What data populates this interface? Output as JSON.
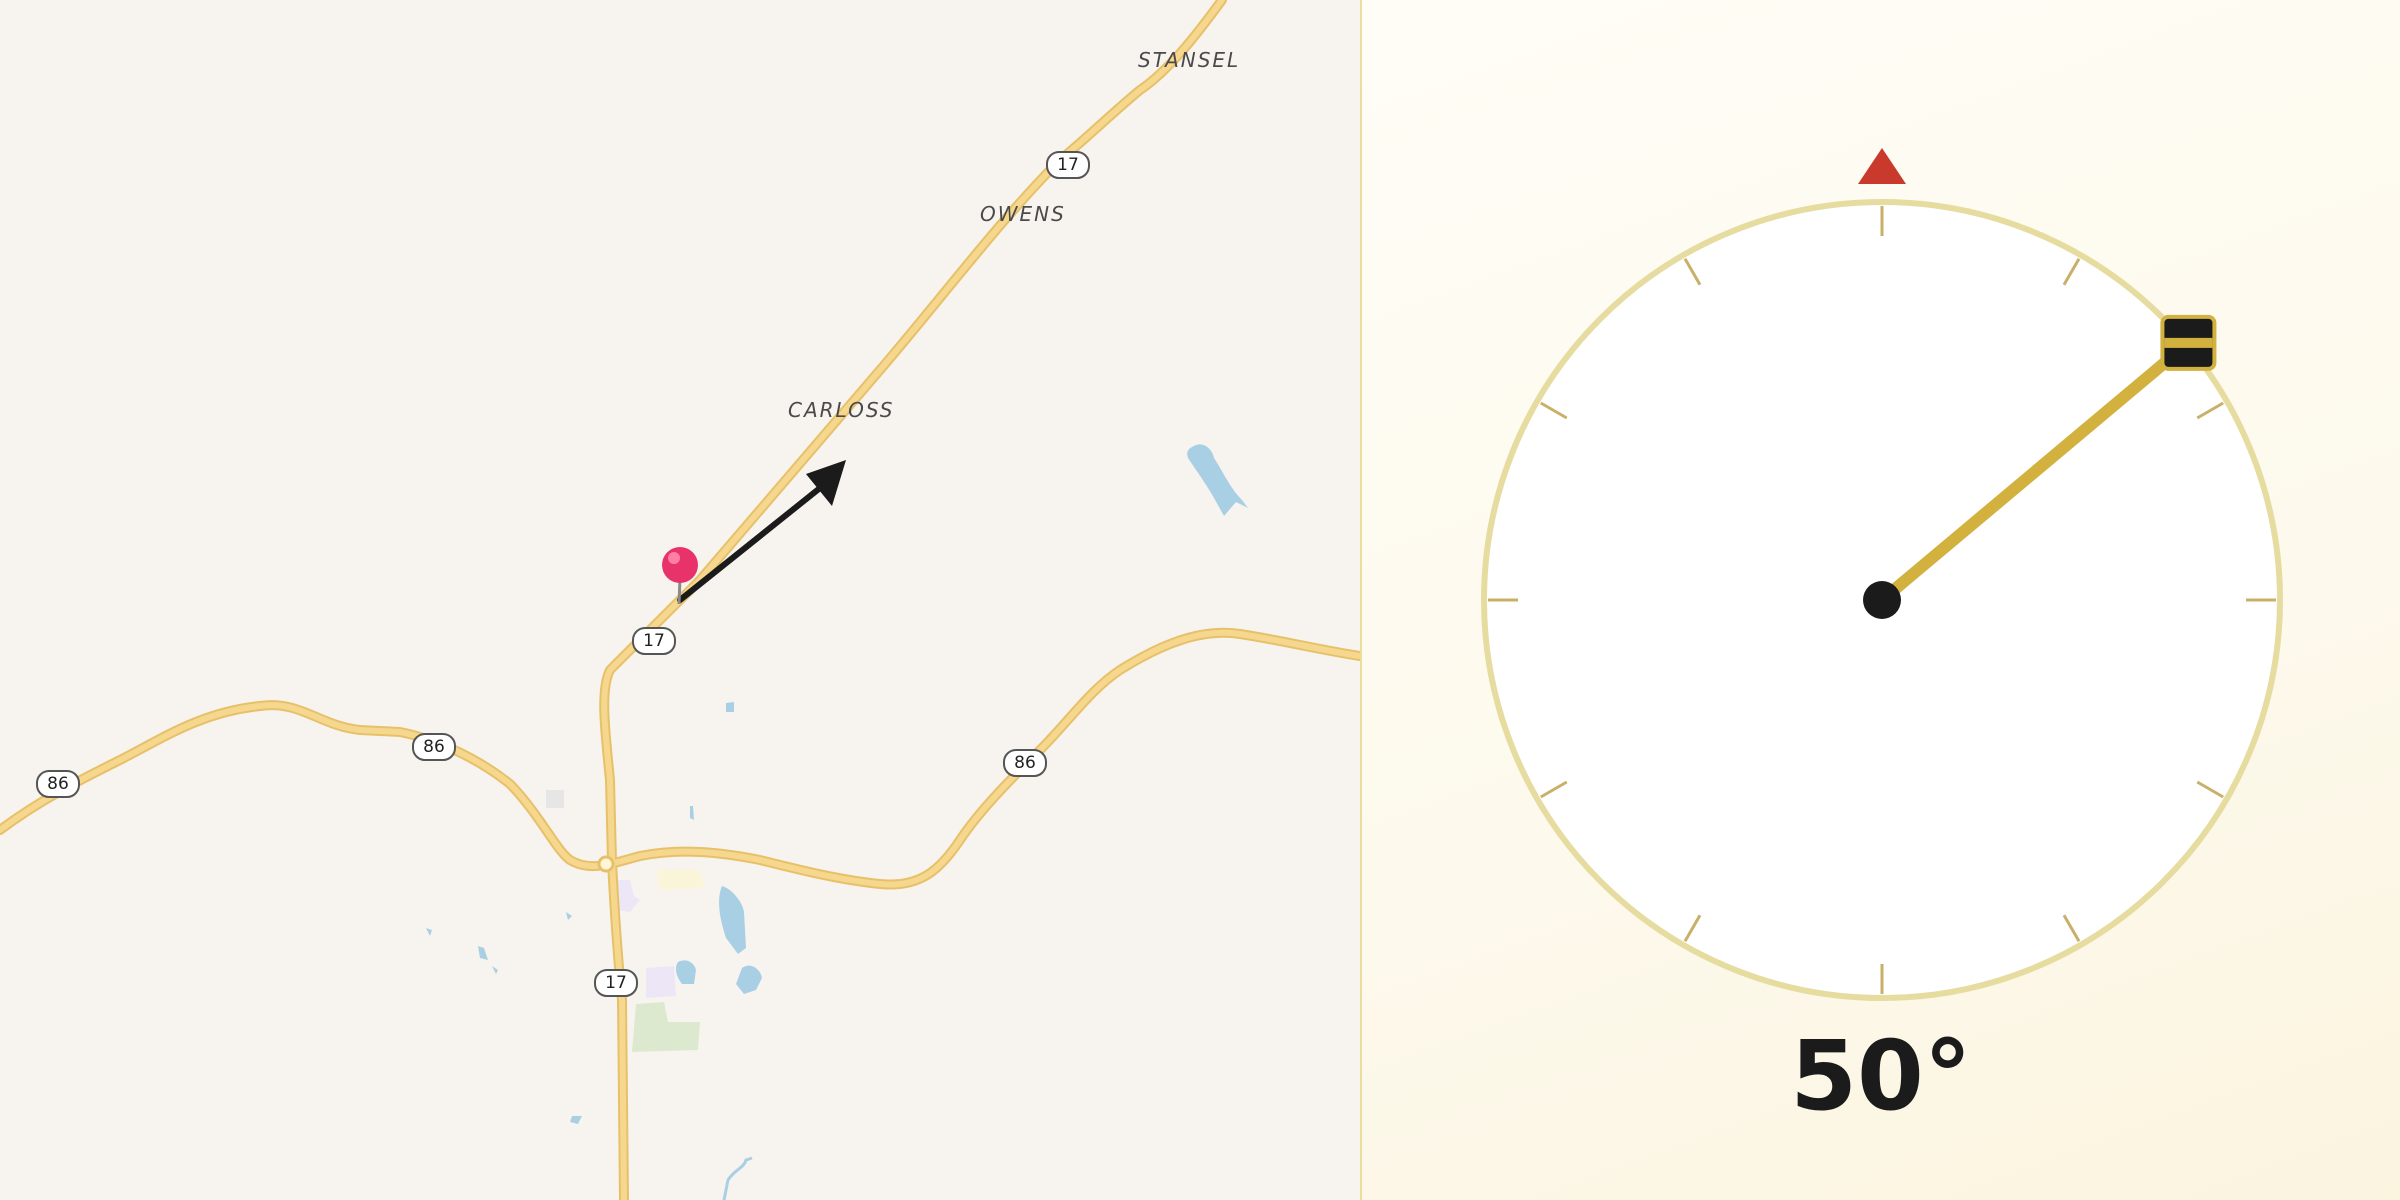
{
  "map": {
    "places": [
      {
        "id": "stansel",
        "label": "STANSEL"
      },
      {
        "id": "owens",
        "label": "OWENS"
      },
      {
        "id": "carloss",
        "label": "CARLOSS"
      }
    ],
    "route_shields": [
      {
        "id": "r17-north",
        "label": "17"
      },
      {
        "id": "r17-mid",
        "label": "17"
      },
      {
        "id": "r17-south",
        "label": "17"
      },
      {
        "id": "r86-west",
        "label": "86"
      },
      {
        "id": "r86-midwest",
        "label": "86"
      },
      {
        "id": "r86-east",
        "label": "86"
      }
    ],
    "icons": {
      "pin": "map-pin-icon",
      "direction_arrow": "direction-arrow-icon"
    },
    "colors": {
      "land": "#f7f4ef",
      "road": "#f6d27e",
      "water": "#a9cfe5",
      "pin": "#e8326a"
    }
  },
  "compass": {
    "heading_degrees": 50,
    "heading_label": "50°",
    "icons": {
      "north_marker": "north-triangle-icon",
      "needle_handle": "needle-handle-icon"
    },
    "colors": {
      "ring": "#e6dca0",
      "needle": "#d2b13e",
      "north_marker": "#c93a2c",
      "hub": "#1b1b1b"
    }
  }
}
